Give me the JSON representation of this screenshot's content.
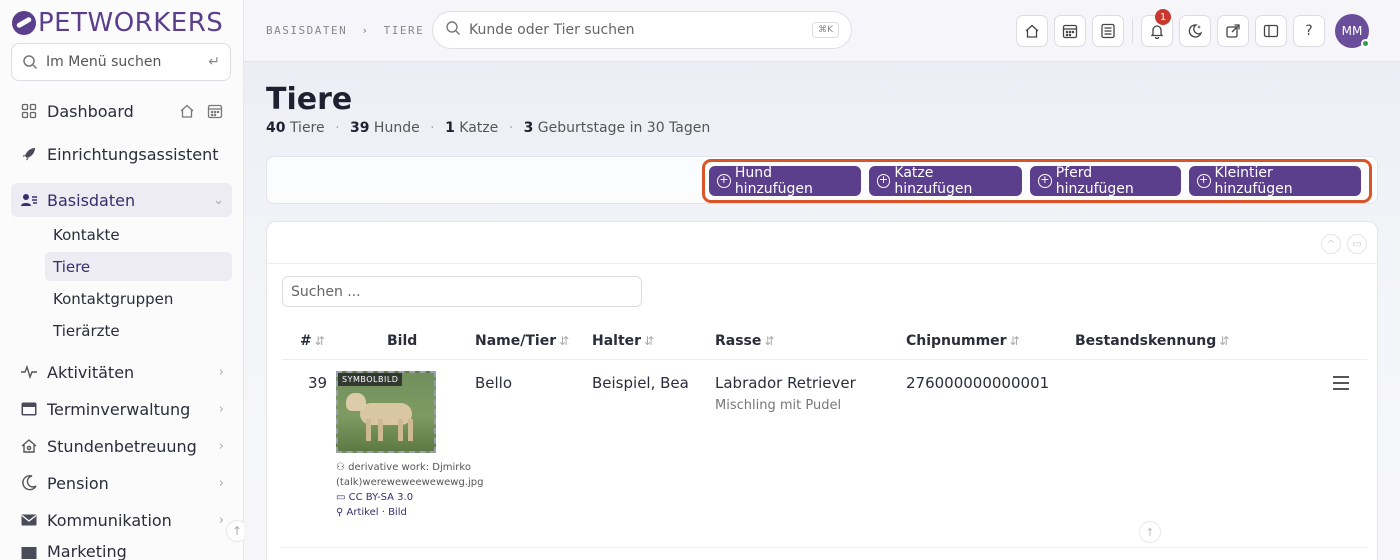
{
  "app": {
    "brand": "PETWORKERS",
    "menu_search_placeholder": "Im Menü suchen"
  },
  "sidebar": {
    "items": [
      {
        "label": "Dashboard",
        "icon": "grid-icon"
      },
      {
        "label": "Einrichtungsassistent",
        "icon": "rocket-icon"
      },
      {
        "label": "Basisdaten",
        "icon": "contacts-icon",
        "active": true
      },
      {
        "label": "Aktivitäten",
        "icon": "activity-icon"
      },
      {
        "label": "Terminverwaltung",
        "icon": "calendar-icon"
      },
      {
        "label": "Stundenbetreuung",
        "icon": "house-icon"
      },
      {
        "label": "Pension",
        "icon": "moon-icon"
      },
      {
        "label": "Kommunikation",
        "icon": "mail-icon"
      },
      {
        "label": "Marketing",
        "icon": "megaphone-icon"
      }
    ],
    "sub_items": [
      "Kontakte",
      "Tiere",
      "Kontaktgruppen",
      "Tierärzte"
    ]
  },
  "topbar": {
    "breadcrumb": [
      "BASISDATEN",
      "TIERE"
    ],
    "search_placeholder": "Kunde oder Tier suchen",
    "search_shortcut": "⌘K",
    "notification_count": "1",
    "avatar_initials": "MM"
  },
  "page": {
    "title": "Tiere",
    "stats": {
      "tiere_count": "40",
      "tiere_label": "Tiere",
      "hunde_count": "39",
      "hunde_label": "Hunde",
      "katze_count": "1",
      "katze_label": "Katze",
      "birthdays_count": "3",
      "birthdays_label": "Geburtstage in 30 Tagen"
    }
  },
  "actions": {
    "add_dog": "Hund hinzufügen",
    "add_cat": "Katze hinzufügen",
    "add_horse": "Pferd hinzufügen",
    "add_small": "Kleintier hinzufügen"
  },
  "table": {
    "search_placeholder": "Suchen ...",
    "columns": [
      "#",
      "Bild",
      "Name/Tier",
      "Halter",
      "Rasse",
      "Chipnummer",
      "Bestandskennung"
    ],
    "rows": [
      {
        "id": "39",
        "image_tag": "SYMBOLBILD",
        "credit_author": "derivative work: Djmirko (talk)wereweweewewewg.jpg",
        "credit_license": "CC BY-SA 3.0",
        "credit_links": "Artikel · Bild",
        "name": "Bello",
        "owner": "Beispiel, Bea",
        "breed": "Labrador Retriever",
        "breed_note": "Mischling mit Pudel",
        "chip": "276000000000001",
        "stock_id": ""
      }
    ]
  },
  "colors": {
    "accent": "#5b3f8c",
    "highlight": "#d95528",
    "notification": "#c8382f"
  }
}
